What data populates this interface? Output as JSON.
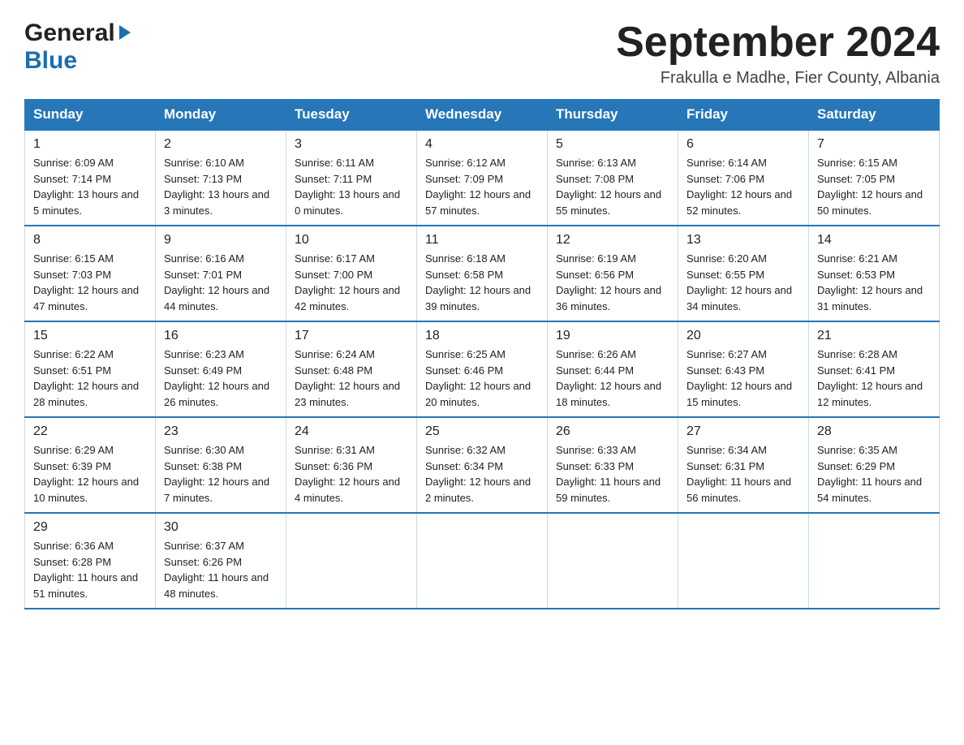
{
  "logo": {
    "general": "General",
    "blue": "Blue",
    "triangle": "▶"
  },
  "title": "September 2024",
  "subtitle": "Frakulla e Madhe, Fier County, Albania",
  "days_of_week": [
    "Sunday",
    "Monday",
    "Tuesday",
    "Wednesday",
    "Thursday",
    "Friday",
    "Saturday"
  ],
  "weeks": [
    [
      {
        "day": "1",
        "sunrise": "6:09 AM",
        "sunset": "7:14 PM",
        "daylight": "13 hours and 5 minutes."
      },
      {
        "day": "2",
        "sunrise": "6:10 AM",
        "sunset": "7:13 PM",
        "daylight": "13 hours and 3 minutes."
      },
      {
        "day": "3",
        "sunrise": "6:11 AM",
        "sunset": "7:11 PM",
        "daylight": "13 hours and 0 minutes."
      },
      {
        "day": "4",
        "sunrise": "6:12 AM",
        "sunset": "7:09 PM",
        "daylight": "12 hours and 57 minutes."
      },
      {
        "day": "5",
        "sunrise": "6:13 AM",
        "sunset": "7:08 PM",
        "daylight": "12 hours and 55 minutes."
      },
      {
        "day": "6",
        "sunrise": "6:14 AM",
        "sunset": "7:06 PM",
        "daylight": "12 hours and 52 minutes."
      },
      {
        "day": "7",
        "sunrise": "6:15 AM",
        "sunset": "7:05 PM",
        "daylight": "12 hours and 50 minutes."
      }
    ],
    [
      {
        "day": "8",
        "sunrise": "6:15 AM",
        "sunset": "7:03 PM",
        "daylight": "12 hours and 47 minutes."
      },
      {
        "day": "9",
        "sunrise": "6:16 AM",
        "sunset": "7:01 PM",
        "daylight": "12 hours and 44 minutes."
      },
      {
        "day": "10",
        "sunrise": "6:17 AM",
        "sunset": "7:00 PM",
        "daylight": "12 hours and 42 minutes."
      },
      {
        "day": "11",
        "sunrise": "6:18 AM",
        "sunset": "6:58 PM",
        "daylight": "12 hours and 39 minutes."
      },
      {
        "day": "12",
        "sunrise": "6:19 AM",
        "sunset": "6:56 PM",
        "daylight": "12 hours and 36 minutes."
      },
      {
        "day": "13",
        "sunrise": "6:20 AM",
        "sunset": "6:55 PM",
        "daylight": "12 hours and 34 minutes."
      },
      {
        "day": "14",
        "sunrise": "6:21 AM",
        "sunset": "6:53 PM",
        "daylight": "12 hours and 31 minutes."
      }
    ],
    [
      {
        "day": "15",
        "sunrise": "6:22 AM",
        "sunset": "6:51 PM",
        "daylight": "12 hours and 28 minutes."
      },
      {
        "day": "16",
        "sunrise": "6:23 AM",
        "sunset": "6:49 PM",
        "daylight": "12 hours and 26 minutes."
      },
      {
        "day": "17",
        "sunrise": "6:24 AM",
        "sunset": "6:48 PM",
        "daylight": "12 hours and 23 minutes."
      },
      {
        "day": "18",
        "sunrise": "6:25 AM",
        "sunset": "6:46 PM",
        "daylight": "12 hours and 20 minutes."
      },
      {
        "day": "19",
        "sunrise": "6:26 AM",
        "sunset": "6:44 PM",
        "daylight": "12 hours and 18 minutes."
      },
      {
        "day": "20",
        "sunrise": "6:27 AM",
        "sunset": "6:43 PM",
        "daylight": "12 hours and 15 minutes."
      },
      {
        "day": "21",
        "sunrise": "6:28 AM",
        "sunset": "6:41 PM",
        "daylight": "12 hours and 12 minutes."
      }
    ],
    [
      {
        "day": "22",
        "sunrise": "6:29 AM",
        "sunset": "6:39 PM",
        "daylight": "12 hours and 10 minutes."
      },
      {
        "day": "23",
        "sunrise": "6:30 AM",
        "sunset": "6:38 PM",
        "daylight": "12 hours and 7 minutes."
      },
      {
        "day": "24",
        "sunrise": "6:31 AM",
        "sunset": "6:36 PM",
        "daylight": "12 hours and 4 minutes."
      },
      {
        "day": "25",
        "sunrise": "6:32 AM",
        "sunset": "6:34 PM",
        "daylight": "12 hours and 2 minutes."
      },
      {
        "day": "26",
        "sunrise": "6:33 AM",
        "sunset": "6:33 PM",
        "daylight": "11 hours and 59 minutes."
      },
      {
        "day": "27",
        "sunrise": "6:34 AM",
        "sunset": "6:31 PM",
        "daylight": "11 hours and 56 minutes."
      },
      {
        "day": "28",
        "sunrise": "6:35 AM",
        "sunset": "6:29 PM",
        "daylight": "11 hours and 54 minutes."
      }
    ],
    [
      {
        "day": "29",
        "sunrise": "6:36 AM",
        "sunset": "6:28 PM",
        "daylight": "11 hours and 51 minutes."
      },
      {
        "day": "30",
        "sunrise": "6:37 AM",
        "sunset": "6:26 PM",
        "daylight": "11 hours and 48 minutes."
      },
      null,
      null,
      null,
      null,
      null
    ]
  ],
  "labels": {
    "sunrise": "Sunrise:",
    "sunset": "Sunset:",
    "daylight": "Daylight:"
  }
}
